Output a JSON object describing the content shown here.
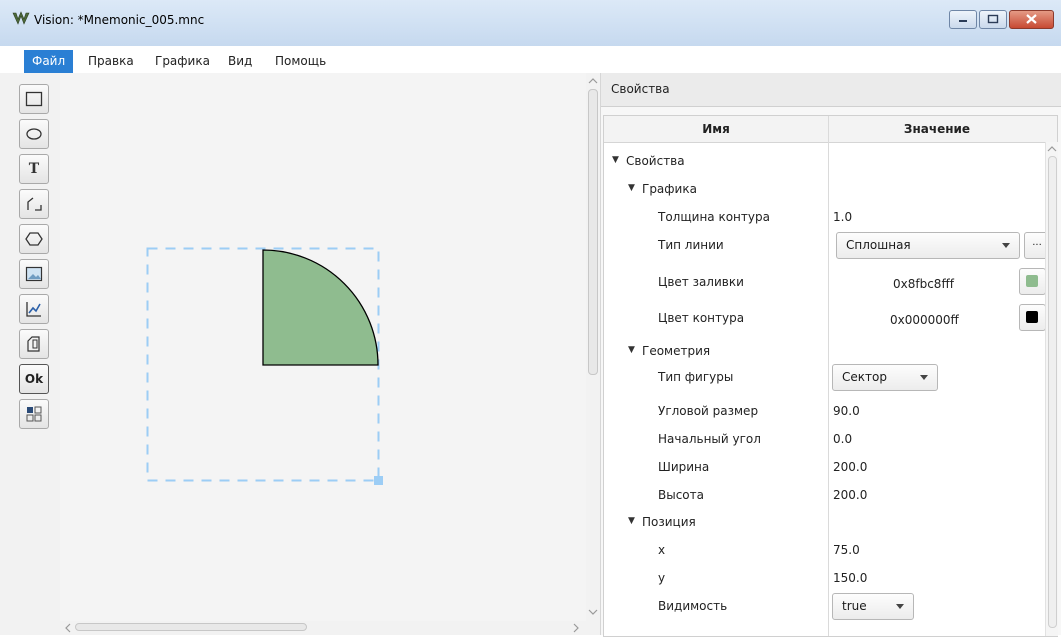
{
  "window": {
    "title": "Vision: *Mnemonic_005.mnc",
    "minimize_icon": "minimize-icon",
    "maximize_icon": "maximize-icon",
    "close_icon": "close-icon"
  },
  "menu": {
    "items": [
      {
        "label": "Файл",
        "active": true
      },
      {
        "label": "Правка"
      },
      {
        "label": "Графика"
      },
      {
        "label": "Вид"
      },
      {
        "label": "Помощь"
      }
    ]
  },
  "toolbar": {
    "tools": [
      {
        "icon": "rectangle-icon"
      },
      {
        "icon": "ellipse-icon"
      },
      {
        "icon": "text-icon",
        "glyph": "T"
      },
      {
        "icon": "polyline-icon"
      },
      {
        "icon": "polygon-icon"
      },
      {
        "icon": "image-icon"
      },
      {
        "icon": "chart-icon"
      },
      {
        "icon": "device-icon"
      },
      {
        "icon": "button-icon",
        "glyph": "Ok"
      },
      {
        "icon": "grid-icon"
      }
    ]
  },
  "canvas": {
    "shape": {
      "type": "sector",
      "fill": "#8fbc8f",
      "stroke": "#000000"
    },
    "selection_color": "#9ccdf5"
  },
  "properties": {
    "title": "Свойства",
    "columns": {
      "name": "Имя",
      "value": "Значение"
    },
    "rows": {
      "root": "Свойства",
      "graphics": "Графика",
      "stroke_width": {
        "name": "Толщина контура",
        "value": "1.0"
      },
      "line_type": {
        "name": "Тип линии",
        "value": "Сплошная",
        "more": "..."
      },
      "fill_color": {
        "name": "Цвет заливки",
        "value": "0x8fbc8fff",
        "color": "#8fbc8f"
      },
      "stroke_color": {
        "name": "Цвет контура",
        "value": "0x000000ff",
        "color": "#000000"
      },
      "geometry": "Геометрия",
      "shape_type": {
        "name": "Тип фигуры",
        "value": "Сектор"
      },
      "angle_size": {
        "name": "Угловой размер",
        "value": "90.0"
      },
      "start_angle": {
        "name": "Начальный угол",
        "value": "0.0"
      },
      "width": {
        "name": "Ширина",
        "value": "200.0"
      },
      "height": {
        "name": "Высота",
        "value": "200.0"
      },
      "position": "Позиция",
      "x": {
        "name": "x",
        "value": "75.0"
      },
      "y": {
        "name": "y",
        "value": "150.0"
      },
      "visibility": {
        "name": "Видимость",
        "value": "true"
      }
    }
  }
}
